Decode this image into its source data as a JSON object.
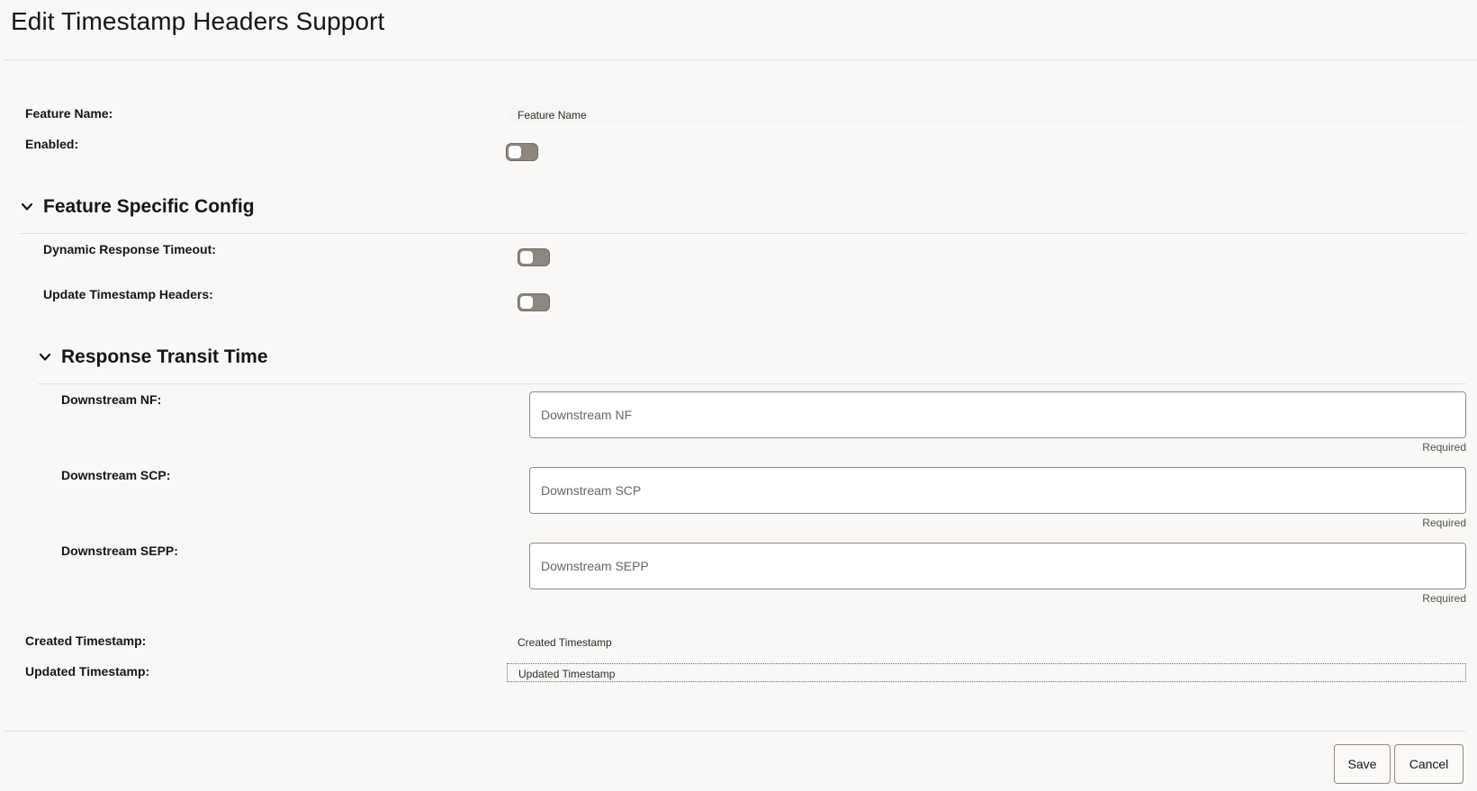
{
  "page": {
    "title": "Edit Timestamp Headers Support"
  },
  "general": {
    "feature_name_label": "Feature Name:",
    "feature_name_value": "Feature Name",
    "enabled_label": "Enabled:",
    "enabled_on": false
  },
  "feature_specific": {
    "title": "Feature Specific Config",
    "expanded": true,
    "dynamic_response_timeout_label": "Dynamic Response Timeout:",
    "dynamic_response_timeout_on": false,
    "update_timestamp_headers_label": "Update Timestamp Headers:",
    "update_timestamp_headers_on": false,
    "response_transit_time": {
      "title": "Response Transit Time",
      "expanded": true,
      "fields": [
        {
          "label": "Downstream NF:",
          "placeholder": "Downstream NF",
          "hint": "Required"
        },
        {
          "label": "Downstream SCP:",
          "placeholder": "Downstream SCP",
          "hint": "Required"
        },
        {
          "label": "Downstream SEPP:",
          "placeholder": "Downstream SEPP",
          "hint": "Required"
        }
      ]
    }
  },
  "timestamps": {
    "created_label": "Created Timestamp:",
    "created_value": "Created Timestamp",
    "updated_label": "Updated Timestamp:",
    "updated_value": "Updated Timestamp"
  },
  "footer": {
    "save_label": "Save",
    "cancel_label": "Cancel"
  }
}
